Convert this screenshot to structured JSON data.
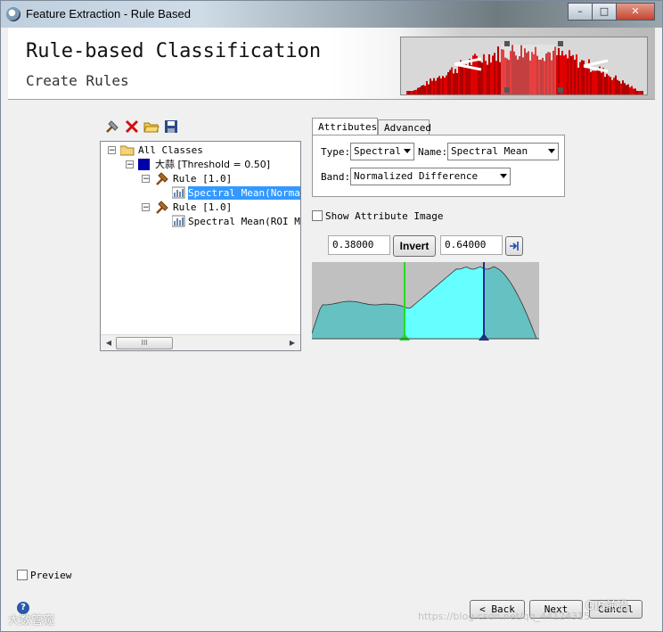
{
  "window": {
    "title": "Feature Extraction - Rule Based",
    "controls": [
      "minimize",
      "maximize",
      "close"
    ]
  },
  "header": {
    "title": "Rule-based Classification",
    "subtitle": "Create Rules"
  },
  "toolbar": {
    "icons": [
      "add-rule-icon",
      "delete-icon",
      "open-folder-icon",
      "save-icon"
    ]
  },
  "tree": {
    "root": "All Classes",
    "class_label": "大蒜 [Threshold = 0.50]",
    "rule1": "Rule [1.0]",
    "rule1_child": "Spectral Mean(Normalized Difference)",
    "rule2": "Rule [1.0]",
    "rule2_child": "Spectral Mean(ROI Mask)",
    "class_color": "#0000aa",
    "scroll_thumb": "III"
  },
  "tabs": [
    {
      "label": "Attributes",
      "active": true
    },
    {
      "label": "Advanced",
      "active": false
    }
  ],
  "attributes": {
    "type_label": "Type:",
    "type_value": "Spectral",
    "name_label": "Name:",
    "name_value": "Spectral Mean",
    "band_label": "Band:",
    "band_value": "Normalized Difference"
  },
  "show_attribute_image": {
    "label": "Show Attribute Image",
    "checked": false
  },
  "threshold": {
    "low": "0.38000",
    "invert_label": "Invert",
    "high": "0.64000"
  },
  "histogram": {
    "low_marker_color": "#22dd22",
    "high_marker_color": "#1a2a8a",
    "fill_selected": "#66ffff",
    "fill_outside": "#66c2c2"
  },
  "preview": {
    "label": "Preview",
    "checked": false
  },
  "buttons": {
    "back": "< Back",
    "next": "Next",
    "cancel": "Cancel"
  },
  "watermarks": {
    "bottom_left": "大数管窥",
    "bottom_center": "https://blog.csdn.net/qq_44124315",
    "bottom_right": "GIS前沿"
  }
}
